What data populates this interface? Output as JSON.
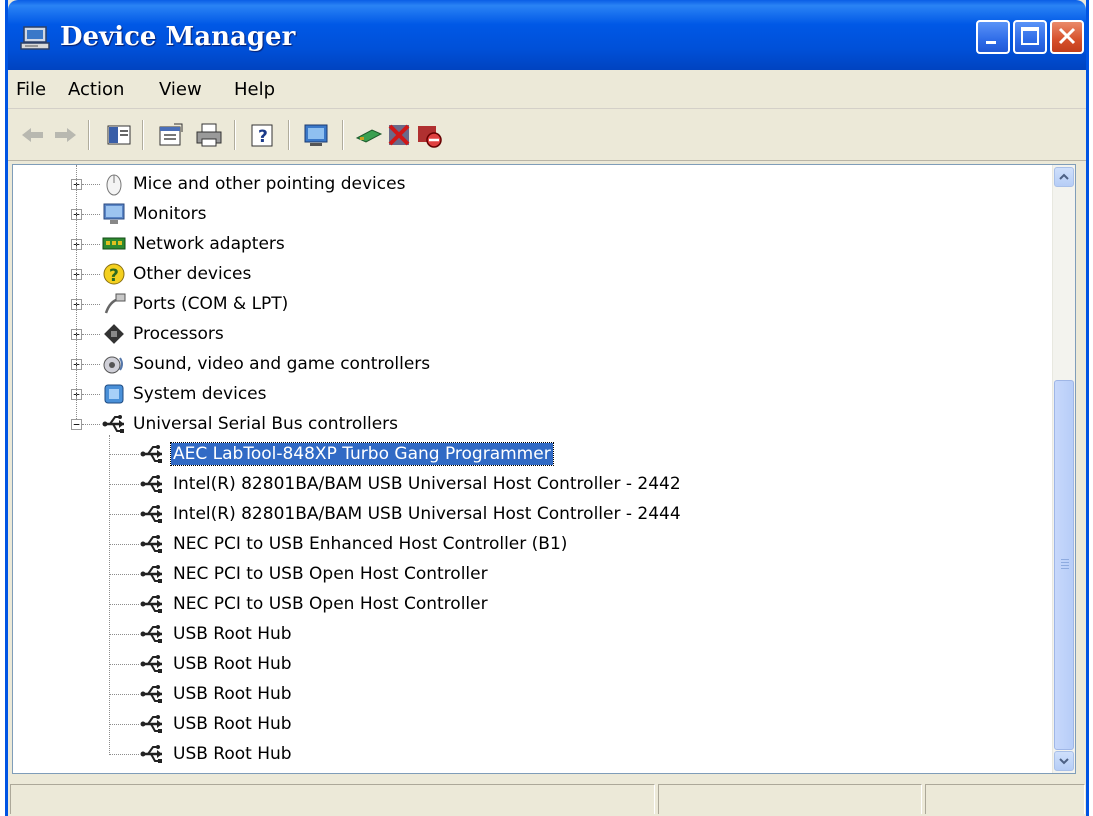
{
  "window": {
    "title": "Device Manager"
  },
  "menu": {
    "file": "File",
    "action": "Action",
    "view": "View",
    "help": "Help"
  },
  "tree": {
    "categories": [
      {
        "label": "Mice and other pointing devices",
        "icon": "mouse-icon",
        "expanded": false
      },
      {
        "label": "Monitors",
        "icon": "monitor-icon",
        "expanded": false
      },
      {
        "label": "Network adapters",
        "icon": "network-card-icon",
        "expanded": false
      },
      {
        "label": "Other devices",
        "icon": "unknown-device-icon",
        "expanded": false
      },
      {
        "label": "Ports (COM & LPT)",
        "icon": "port-icon",
        "expanded": false
      },
      {
        "label": "Processors",
        "icon": "processor-icon",
        "expanded": false
      },
      {
        "label": "Sound, video and game controllers",
        "icon": "sound-icon",
        "expanded": false
      },
      {
        "label": "System devices",
        "icon": "system-icon",
        "expanded": false
      },
      {
        "label": "Universal Serial Bus controllers",
        "icon": "usb-icon",
        "expanded": true
      }
    ],
    "usb_devices": [
      {
        "label": "AEC LabTool-848XP Turbo Gang Programmer",
        "selected": true
      },
      {
        "label": "Intel(R) 82801BA/BAM USB Universal Host Controller - 2442"
      },
      {
        "label": "Intel(R) 82801BA/BAM USB Universal Host Controller - 2444"
      },
      {
        "label": "NEC PCI to USB Enhanced Host Controller (B1)"
      },
      {
        "label": "NEC PCI to USB Open Host Controller"
      },
      {
        "label": "NEC PCI to USB Open Host Controller"
      },
      {
        "label": "USB Root Hub"
      },
      {
        "label": "USB Root Hub"
      },
      {
        "label": "USB Root Hub"
      },
      {
        "label": "USB Root Hub"
      },
      {
        "label": "USB Root Hub"
      }
    ]
  },
  "colors": {
    "titlebar": "#0054e3",
    "selection": "#316ac5",
    "chrome": "#ece9d8"
  }
}
